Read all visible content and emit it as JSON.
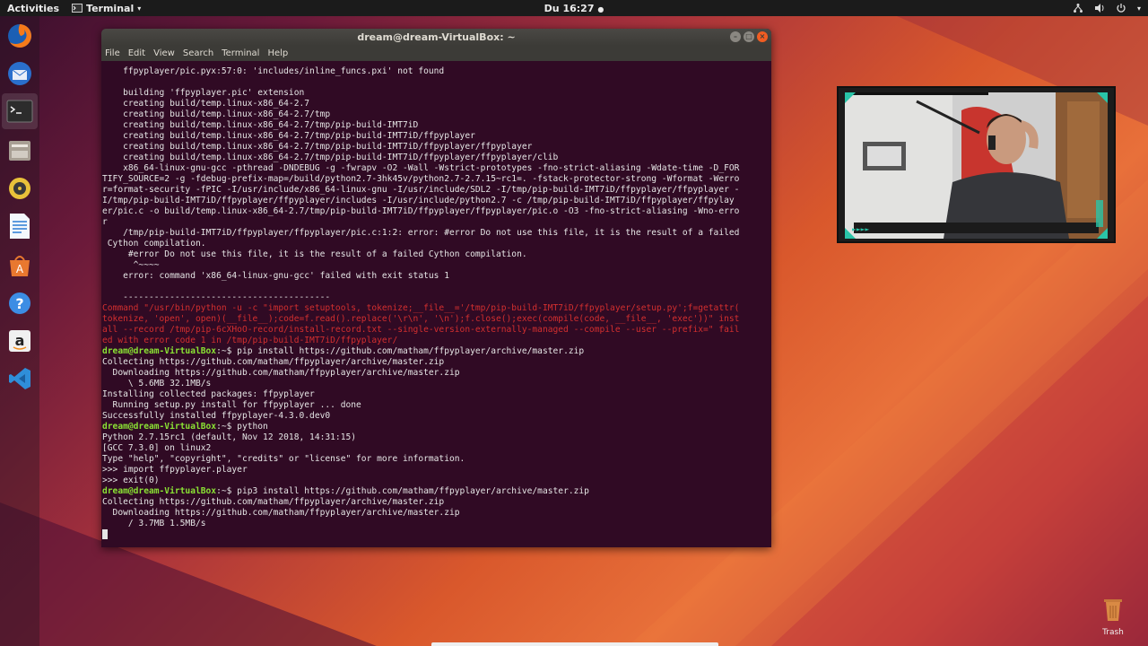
{
  "topbar": {
    "activities": "Activities",
    "app_menu": "Terminal",
    "clock": "Du 16:27"
  },
  "dock": {
    "items": [
      "firefox-icon",
      "thunderbird-icon",
      "terminal-icon",
      "files-icon",
      "rhythmbox-icon",
      "libreoffice-writer-icon",
      "software-center-icon",
      "help-icon",
      "amazon-icon",
      "vscode-icon"
    ]
  },
  "terminal": {
    "title": "dream@dream-VirtualBox: ~",
    "menu": [
      "File",
      "Edit",
      "View",
      "Search",
      "Terminal",
      "Help"
    ],
    "lines": [
      {
        "t": "    ffpyplayer/pic.pyx:57:0: 'includes/inline_funcs.pxi' not found",
        "c": ""
      },
      {
        "t": "",
        "c": ""
      },
      {
        "t": "    building 'ffpyplayer.pic' extension",
        "c": ""
      },
      {
        "t": "    creating build/temp.linux-x86_64-2.7",
        "c": ""
      },
      {
        "t": "    creating build/temp.linux-x86_64-2.7/tmp",
        "c": ""
      },
      {
        "t": "    creating build/temp.linux-x86_64-2.7/tmp/pip-build-IMT7iD",
        "c": ""
      },
      {
        "t": "    creating build/temp.linux-x86_64-2.7/tmp/pip-build-IMT7iD/ffpyplayer",
        "c": ""
      },
      {
        "t": "    creating build/temp.linux-x86_64-2.7/tmp/pip-build-IMT7iD/ffpyplayer/ffpyplayer",
        "c": ""
      },
      {
        "t": "    creating build/temp.linux-x86_64-2.7/tmp/pip-build-IMT7iD/ffpyplayer/ffpyplayer/clib",
        "c": ""
      },
      {
        "t": "    x86_64-linux-gnu-gcc -pthread -DNDEBUG -g -fwrapv -O2 -Wall -Wstrict-prototypes -fno-strict-aliasing -Wdate-time -D_FOR",
        "c": ""
      },
      {
        "t": "TIFY_SOURCE=2 -g -fdebug-prefix-map=/build/python2.7-3hk45v/python2.7-2.7.15~rc1=. -fstack-protector-strong -Wformat -Werro",
        "c": ""
      },
      {
        "t": "r=format-security -fPIC -I/usr/include/x86_64-linux-gnu -I/usr/include/SDL2 -I/tmp/pip-build-IMT7iD/ffpyplayer/ffpyplayer -",
        "c": ""
      },
      {
        "t": "I/tmp/pip-build-IMT7iD/ffpyplayer/ffpyplayer/includes -I/usr/include/python2.7 -c /tmp/pip-build-IMT7iD/ffpyplayer/ffpylay",
        "c": ""
      },
      {
        "t": "er/pic.c -o build/temp.linux-x86_64-2.7/tmp/pip-build-IMT7iD/ffpyplayer/ffpyplayer/pic.o -O3 -fno-strict-aliasing -Wno-erro",
        "c": ""
      },
      {
        "t": "r",
        "c": ""
      },
      {
        "t": "    /tmp/pip-build-IMT7iD/ffpyplayer/ffpyplayer/pic.c:1:2: error: #error Do not use this file, it is the result of a failed",
        "c": ""
      },
      {
        "t": " Cython compilation.",
        "c": ""
      },
      {
        "t": "     #error Do not use this file, it is the result of a failed Cython compilation.",
        "c": ""
      },
      {
        "t": "      ^~~~~",
        "c": ""
      },
      {
        "t": "    error: command 'x86_64-linux-gnu-gcc' failed with exit status 1",
        "c": ""
      },
      {
        "t": "",
        "c": ""
      },
      {
        "t": "    ----------------------------------------",
        "c": ""
      },
      {
        "t": "Command \"/usr/bin/python -u -c \"import setuptools, tokenize;__file__='/tmp/pip-build-IMT7iD/ffpyplayer/setup.py';f=getattr(",
        "c": "red"
      },
      {
        "t": "tokenize, 'open', open)(__file__);code=f.read().replace('\\r\\n', '\\n');f.close();exec(compile(code, __file__, 'exec'))\" inst",
        "c": "red"
      },
      {
        "t": "all --record /tmp/pip-6cXHoO-record/install-record.txt --single-version-externally-managed --compile --user --prefix=\" fail",
        "c": "red"
      },
      {
        "t": "ed with error code 1 in /tmp/pip-build-IMT7iD/ffpyplayer/",
        "c": "red"
      },
      {
        "p": "dream@dream-VirtualBox",
        "t": ":~$ pip install https://github.com/matham/ffpyplayer/archive/master.zip",
        "c": ""
      },
      {
        "t": "Collecting https://github.com/matham/ffpyplayer/archive/master.zip",
        "c": ""
      },
      {
        "t": "  Downloading https://github.com/matham/ffpyplayer/archive/master.zip",
        "c": ""
      },
      {
        "t": "     \\ 5.6MB 32.1MB/s",
        "c": ""
      },
      {
        "t": "Installing collected packages: ffpyplayer",
        "c": ""
      },
      {
        "t": "  Running setup.py install for ffpyplayer ... done",
        "c": ""
      },
      {
        "t": "Successfully installed ffpyplayer-4.3.0.dev0",
        "c": ""
      },
      {
        "p": "dream@dream-VirtualBox",
        "t": ":~$ python",
        "c": ""
      },
      {
        "t": "Python 2.7.15rc1 (default, Nov 12 2018, 14:31:15)",
        "c": ""
      },
      {
        "t": "[GCC 7.3.0] on linux2",
        "c": ""
      },
      {
        "t": "Type \"help\", \"copyright\", \"credits\" or \"license\" for more information.",
        "c": ""
      },
      {
        "t": ">>> import ffpyplayer.player",
        "c": ""
      },
      {
        "t": ">>> exit(0)",
        "c": ""
      },
      {
        "p": "dream@dream-VirtualBox",
        "t": ":~$ pip3 install https://github.com/matham/ffpyplayer/archive/master.zip",
        "c": ""
      },
      {
        "t": "Collecting https://github.com/matham/ffpyplayer/archive/master.zip",
        "c": ""
      },
      {
        "t": "  Downloading https://github.com/matham/ffpyplayer/archive/master.zip",
        "c": ""
      },
      {
        "t": "     / 3.7MB 1.5MB/s",
        "c": ""
      }
    ]
  },
  "trash": {
    "label": "Trash"
  },
  "colors": {
    "prompt": "#8ae234",
    "error": "#d32f2f",
    "terminal_bg": "#300a24"
  }
}
